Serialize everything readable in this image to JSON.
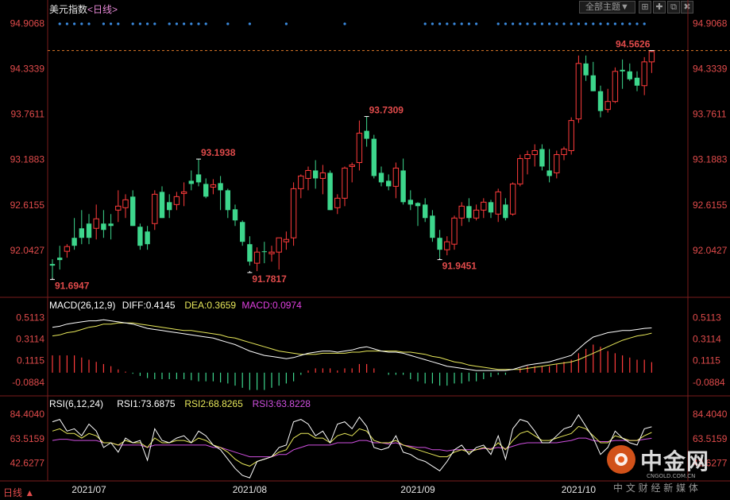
{
  "header": {
    "instrument": "美元指数",
    "period": "<日线>",
    "theme_button": "全部主题",
    "theme_arrow": "▼"
  },
  "window_controls": [
    {
      "name": "grid-icon",
      "glyph": "⊞"
    },
    {
      "name": "expand-icon",
      "glyph": "✚"
    },
    {
      "name": "restore-icon",
      "glyph": "⧉"
    },
    {
      "name": "close-icon",
      "glyph": "✖"
    }
  ],
  "footer": {
    "period_button": "日线 ▲"
  },
  "watermark": {
    "brand": "中金网",
    "site": "CNGOLD.COM.CN",
    "tagline": "中 文 财 经 新 媒 体"
  },
  "colors": {
    "up": "#ff3b3b",
    "down": "#3dd68c",
    "axis": "#e14b4b",
    "diff": "#ffffff",
    "dea": "#e8e85a",
    "macd": "#e040e0",
    "rsi3": "#d050e0"
  },
  "chart_data": [
    {
      "type": "candlestick",
      "title": "美元指数 <日线>",
      "ylim": [
        91.47,
        95.0
      ],
      "ytick_labels": [
        "94.9068",
        "94.3339",
        "93.7611",
        "93.1883",
        "92.6155",
        "92.0427"
      ],
      "xtick_labels": [
        "2021/07",
        "2021/08",
        "2021/09",
        "2021/10"
      ],
      "annotations": [
        {
          "text": "91.6947",
          "kind": "low",
          "color": "#3dd68c"
        },
        {
          "text": "93.1938",
          "kind": "high",
          "color": "#ff4d4d"
        },
        {
          "text": "91.7817",
          "kind": "low",
          "color": "#3dd68c"
        },
        {
          "text": "93.7309",
          "kind": "high",
          "color": "#ff4d4d"
        },
        {
          "text": "91.9451",
          "kind": "low",
          "color": "#3dd68c"
        },
        {
          "text": "94.5626",
          "kind": "high",
          "color": "#ff4d4d"
        }
      ],
      "ref_line": 94.5626,
      "candles": [
        [
          91.87,
          91.93,
          91.69,
          91.85
        ],
        [
          91.95,
          92.1,
          91.8,
          91.92
        ],
        [
          92.03,
          92.12,
          91.95,
          92.09
        ],
        [
          92.2,
          92.45,
          92.05,
          92.1
        ],
        [
          92.32,
          92.55,
          92.12,
          92.2
        ],
        [
          92.38,
          92.5,
          92.12,
          92.2
        ],
        [
          92.32,
          92.62,
          92.18,
          92.44
        ],
        [
          92.38,
          92.55,
          92.2,
          92.3
        ],
        [
          92.38,
          92.5,
          92.18,
          92.35
        ],
        [
          92.55,
          92.8,
          92.4,
          92.6
        ],
        [
          92.58,
          92.75,
          92.45,
          92.68
        ],
        [
          92.72,
          92.8,
          92.35,
          92.35
        ],
        [
          92.34,
          92.38,
          92.05,
          92.1
        ],
        [
          92.28,
          92.35,
          92.05,
          92.12
        ],
        [
          92.38,
          92.8,
          92.3,
          92.75
        ],
        [
          92.78,
          92.85,
          92.45,
          92.45
        ],
        [
          92.65,
          92.75,
          92.45,
          92.55
        ],
        [
          92.62,
          92.78,
          92.55,
          92.72
        ],
        [
          92.76,
          92.9,
          92.6,
          92.78
        ],
        [
          92.92,
          93.05,
          92.8,
          92.88
        ],
        [
          93.0,
          93.19,
          92.85,
          92.9
        ],
        [
          92.88,
          92.95,
          92.7,
          92.72
        ],
        [
          92.84,
          92.94,
          92.75,
          92.87
        ],
        [
          92.89,
          92.98,
          92.55,
          92.8
        ],
        [
          92.8,
          92.82,
          92.45,
          92.55
        ],
        [
          92.56,
          92.62,
          92.35,
          92.42
        ],
        [
          92.4,
          92.42,
          92.1,
          92.15
        ],
        [
          92.12,
          92.22,
          91.85,
          91.9
        ],
        [
          91.88,
          92.08,
          91.78,
          92.02
        ],
        [
          92.03,
          92.15,
          91.88,
          92.02
        ],
        [
          92.0,
          92.1,
          91.9,
          92.02
        ],
        [
          92.02,
          92.2,
          91.8,
          92.2
        ],
        [
          92.15,
          92.28,
          92.05,
          92.18
        ],
        [
          92.2,
          92.9,
          92.1,
          92.82
        ],
        [
          92.82,
          93.0,
          92.7,
          92.98
        ],
        [
          92.95,
          93.1,
          92.8,
          93.05
        ],
        [
          93.05,
          93.18,
          92.82,
          92.95
        ],
        [
          92.95,
          93.12,
          92.75,
          93.02
        ],
        [
          93.02,
          93.05,
          92.55,
          92.55
        ],
        [
          92.58,
          92.75,
          92.5,
          92.7
        ],
        [
          92.7,
          93.1,
          92.6,
          93.08
        ],
        [
          93.1,
          93.15,
          92.9,
          93.12
        ],
        [
          93.15,
          93.68,
          93.05,
          93.52
        ],
        [
          93.55,
          93.73,
          93.35,
          93.45
        ],
        [
          93.45,
          93.5,
          92.95,
          92.98
        ],
        [
          93.02,
          93.1,
          92.85,
          92.9
        ],
        [
          92.92,
          93.0,
          92.8,
          92.85
        ],
        [
          92.85,
          93.15,
          92.7,
          93.08
        ],
        [
          93.05,
          93.2,
          92.62,
          92.65
        ],
        [
          92.68,
          92.8,
          92.55,
          92.62
        ],
        [
          92.64,
          92.65,
          92.35,
          92.6
        ],
        [
          92.62,
          92.7,
          92.4,
          92.45
        ],
        [
          92.48,
          92.55,
          92.15,
          92.2
        ],
        [
          92.2,
          92.3,
          91.95,
          92.05
        ],
        [
          92.05,
          92.22,
          91.98,
          92.15
        ],
        [
          92.12,
          92.48,
          92.05,
          92.45
        ],
        [
          92.45,
          92.65,
          92.35,
          92.6
        ],
        [
          92.6,
          92.7,
          92.4,
          92.45
        ],
        [
          92.45,
          92.62,
          92.42,
          92.55
        ],
        [
          92.55,
          92.7,
          92.45,
          92.65
        ],
        [
          92.65,
          92.68,
          92.45,
          92.52
        ],
        [
          92.5,
          92.82,
          92.4,
          92.78
        ],
        [
          92.62,
          92.7,
          92.42,
          92.45
        ],
        [
          92.5,
          92.9,
          92.48,
          92.88
        ],
        [
          92.88,
          93.25,
          92.85,
          93.2
        ],
        [
          93.2,
          93.3,
          93.0,
          93.25
        ],
        [
          93.25,
          93.38,
          93.1,
          93.3
        ],
        [
          93.32,
          93.38,
          93.05,
          93.1
        ],
        [
          93.05,
          93.32,
          92.9,
          92.98
        ],
        [
          93.02,
          93.3,
          92.95,
          93.25
        ],
        [
          93.25,
          93.35,
          93.18,
          93.32
        ],
        [
          93.3,
          93.72,
          93.25,
          93.68
        ],
        [
          93.7,
          94.5,
          93.65,
          94.4
        ],
        [
          94.4,
          94.5,
          94.18,
          94.25
        ],
        [
          94.25,
          94.42,
          94.05,
          94.05
        ],
        [
          94.05,
          94.12,
          93.72,
          93.8
        ],
        [
          93.82,
          94.08,
          93.78,
          93.92
        ],
        [
          93.92,
          94.35,
          93.9,
          94.3
        ],
        [
          94.32,
          94.45,
          94.08,
          94.3
        ],
        [
          94.3,
          94.4,
          94.18,
          94.2
        ],
        [
          94.22,
          94.3,
          94.05,
          94.12
        ],
        [
          94.12,
          94.48,
          94.0,
          94.42
        ],
        [
          94.42,
          94.56,
          94.28,
          94.55
        ]
      ]
    },
    {
      "type": "macd",
      "title": "MACD(26,12,9)",
      "readouts": [
        {
          "text": "MACD(26,12,9)",
          "color": "#ffffff"
        },
        {
          "text": "DIFF:0.4145",
          "color": "#ffffff"
        },
        {
          "text": "DEA:0.3659",
          "color": "#e8e85a"
        },
        {
          "text": "MACD:0.0974",
          "color": "#e040e0"
        }
      ],
      "ylim": [
        -0.2,
        0.58
      ],
      "ytick_labels": [
        "0.5113",
        "0.3114",
        "0.1115",
        "-0.0884"
      ],
      "diff": [
        0.42,
        0.43,
        0.45,
        0.46,
        0.47,
        0.48,
        0.48,
        0.49,
        0.48,
        0.47,
        0.46,
        0.45,
        0.43,
        0.41,
        0.4,
        0.39,
        0.38,
        0.37,
        0.36,
        0.35,
        0.34,
        0.33,
        0.32,
        0.3,
        0.28,
        0.26,
        0.23,
        0.2,
        0.18,
        0.16,
        0.15,
        0.14,
        0.13,
        0.14,
        0.16,
        0.18,
        0.19,
        0.2,
        0.2,
        0.19,
        0.2,
        0.21,
        0.23,
        0.24,
        0.22,
        0.2,
        0.19,
        0.19,
        0.18,
        0.16,
        0.14,
        0.12,
        0.1,
        0.08,
        0.06,
        0.05,
        0.04,
        0.03,
        0.02,
        0.02,
        0.02,
        0.02,
        0.02,
        0.03,
        0.05,
        0.07,
        0.08,
        0.09,
        0.1,
        0.12,
        0.14,
        0.16,
        0.22,
        0.28,
        0.33,
        0.35,
        0.37,
        0.38,
        0.39,
        0.39,
        0.4,
        0.41,
        0.4145
      ],
      "dea": [
        0.34,
        0.35,
        0.37,
        0.38,
        0.4,
        0.42,
        0.43,
        0.45,
        0.45,
        0.46,
        0.46,
        0.46,
        0.45,
        0.44,
        0.43,
        0.42,
        0.41,
        0.4,
        0.39,
        0.39,
        0.38,
        0.37,
        0.36,
        0.35,
        0.33,
        0.32,
        0.3,
        0.28,
        0.26,
        0.24,
        0.22,
        0.2,
        0.19,
        0.18,
        0.17,
        0.17,
        0.17,
        0.18,
        0.18,
        0.18,
        0.18,
        0.19,
        0.19,
        0.2,
        0.2,
        0.2,
        0.2,
        0.2,
        0.19,
        0.19,
        0.18,
        0.17,
        0.15,
        0.14,
        0.12,
        0.1,
        0.09,
        0.07,
        0.06,
        0.05,
        0.04,
        0.03,
        0.03,
        0.03,
        0.03,
        0.04,
        0.05,
        0.06,
        0.07,
        0.08,
        0.09,
        0.1,
        0.12,
        0.15,
        0.18,
        0.21,
        0.24,
        0.27,
        0.3,
        0.32,
        0.34,
        0.35,
        0.3659
      ],
      "macd": [
        0.16,
        0.16,
        0.16,
        0.16,
        0.14,
        0.12,
        0.1,
        0.08,
        0.06,
        0.03,
        0.01,
        -0.01,
        -0.03,
        -0.05,
        -0.06,
        -0.06,
        -0.06,
        -0.06,
        -0.06,
        -0.07,
        -0.08,
        -0.08,
        -0.08,
        -0.09,
        -0.1,
        -0.12,
        -0.14,
        -0.16,
        -0.16,
        -0.16,
        -0.14,
        -0.12,
        -0.1,
        -0.08,
        -0.02,
        0.02,
        0.04,
        0.04,
        0.04,
        0.02,
        0.04,
        0.04,
        0.08,
        0.08,
        0.04,
        0.0,
        -0.02,
        -0.02,
        -0.02,
        -0.06,
        -0.08,
        -0.1,
        -0.1,
        -0.12,
        -0.12,
        -0.1,
        -0.1,
        -0.08,
        -0.08,
        -0.06,
        -0.04,
        -0.02,
        -0.02,
        0.0,
        0.04,
        0.06,
        0.06,
        0.06,
        0.06,
        0.08,
        0.1,
        0.12,
        0.18,
        0.22,
        0.26,
        0.24,
        0.2,
        0.18,
        0.16,
        0.14,
        0.12,
        0.12,
        0.0974
      ]
    },
    {
      "type": "rsi",
      "title": "RSI(6,12,24)",
      "readouts": [
        {
          "text": "RSI(6,12,24)",
          "color": "#ffffff"
        },
        {
          "text": "RSI1:73.6875",
          "color": "#ffffff"
        },
        {
          "text": "RSI2:68.8265",
          "color": "#e8e85a"
        },
        {
          "text": "RSI3:63.8228",
          "color": "#d050e0"
        }
      ],
      "ylim": [
        28,
        92
      ],
      "ytick_labels": [
        "84.4040",
        "63.5159",
        "42.6277"
      ],
      "rsi1": [
        78,
        80,
        70,
        72,
        66,
        76,
        70,
        56,
        60,
        52,
        64,
        60,
        62,
        45,
        72,
        62,
        60,
        64,
        66,
        60,
        70,
        66,
        58,
        54,
        46,
        38,
        32,
        30,
        44,
        46,
        48,
        56,
        58,
        78,
        80,
        76,
        66,
        70,
        60,
        76,
        78,
        72,
        82,
        74,
        56,
        54,
        56,
        66,
        52,
        50,
        46,
        44,
        40,
        36,
        44,
        54,
        58,
        50,
        56,
        58,
        50,
        66,
        46,
        72,
        80,
        78,
        70,
        60,
        60,
        66,
        72,
        74,
        84,
        74,
        64,
        50,
        56,
        70,
        64,
        60,
        58,
        72,
        73.69
      ],
      "rsi2": [
        70,
        72,
        68,
        68,
        64,
        68,
        66,
        60,
        60,
        58,
        62,
        60,
        60,
        56,
        64,
        60,
        60,
        62,
        62,
        60,
        64,
        62,
        58,
        56,
        52,
        46,
        42,
        40,
        44,
        46,
        48,
        52,
        54,
        64,
        68,
        68,
        64,
        64,
        60,
        66,
        68,
        66,
        72,
        70,
        62,
        60,
        60,
        62,
        58,
        56,
        54,
        52,
        50,
        48,
        48,
        52,
        54,
        52,
        54,
        56,
        54,
        60,
        54,
        62,
        68,
        70,
        66,
        62,
        62,
        64,
        66,
        68,
        74,
        72,
        66,
        60,
        60,
        66,
        64,
        62,
        62,
        66,
        68.83
      ],
      "rsi3": [
        62,
        63,
        63,
        62,
        62,
        62,
        62,
        60,
        60,
        58,
        58,
        58,
        58,
        56,
        58,
        58,
        58,
        58,
        58,
        58,
        58,
        58,
        56,
        56,
        54,
        52,
        50,
        48,
        48,
        48,
        48,
        50,
        50,
        54,
        56,
        58,
        58,
        58,
        58,
        60,
        60,
        60,
        62,
        62,
        60,
        60,
        59,
        60,
        58,
        57,
        56,
        56,
        54,
        54,
        53,
        54,
        54,
        54,
        54,
        55,
        55,
        56,
        55,
        57,
        59,
        60,
        60,
        60,
        60,
        60,
        61,
        62,
        64,
        64,
        62,
        61,
        61,
        62,
        62,
        62,
        62,
        63,
        63.82
      ]
    }
  ]
}
